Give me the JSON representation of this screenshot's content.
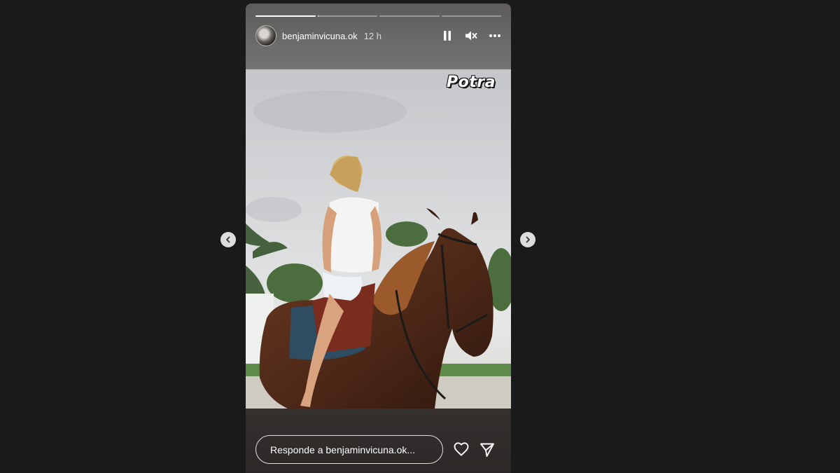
{
  "story": {
    "username": "benjaminvicuna.ok",
    "time_ago": "12 h",
    "sticker_text": "Potra",
    "progress_segments": [
      {
        "fill": 1.0
      },
      {
        "fill": 0.02
      },
      {
        "fill": 0
      },
      {
        "fill": 0
      }
    ]
  },
  "icons": {
    "avatar": "profile-avatar",
    "pause": "pause-icon",
    "mute": "speaker-muted-icon",
    "more": "more-options-icon",
    "like": "heart-icon",
    "share": "send-icon",
    "prev": "chevron-left-icon",
    "next": "chevron-right-icon"
  },
  "reply": {
    "placeholder": "Responde a benjaminvicuna.ok..."
  },
  "colors": {
    "background": "#1a1a1a",
    "text": "#ffffff"
  }
}
